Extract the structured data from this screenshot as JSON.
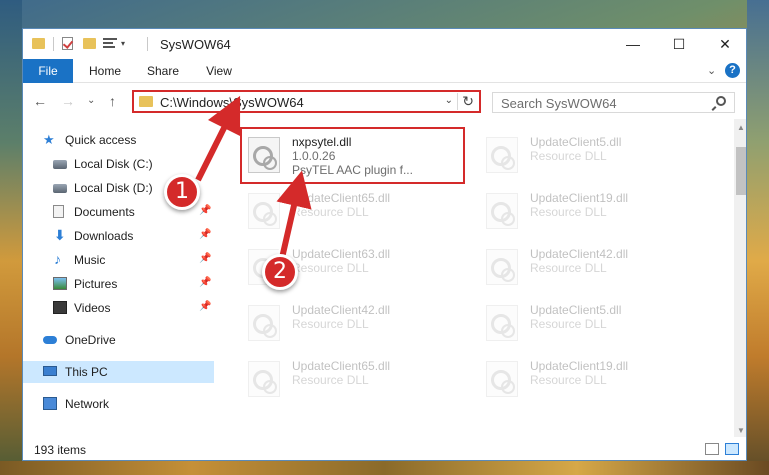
{
  "window": {
    "title": "SysWOW64",
    "minimize_glyph": "—",
    "maximize_glyph": "☐",
    "close_glyph": "✕"
  },
  "ribbon": {
    "tabs": [
      "File",
      "Home",
      "Share",
      "View"
    ],
    "expand_glyph": "⌄",
    "help_glyph": "?"
  },
  "nav": {
    "back_glyph": "←",
    "forward_glyph": "→",
    "recent_glyph": "⌄",
    "up_glyph": "↑",
    "address": "C:\\Windows\\SysWOW64",
    "address_dropdown_glyph": "⌄",
    "refresh_glyph": "↻",
    "search_placeholder": "Search SysWOW64"
  },
  "sidebar": {
    "items": [
      {
        "label": "Quick access",
        "icon": "star-icon"
      },
      {
        "label": "Local Disk (C:)",
        "icon": "disk-icon"
      },
      {
        "label": "Local Disk (D:)",
        "icon": "disk-icon"
      },
      {
        "label": "Documents",
        "icon": "documents-icon",
        "pinned": true
      },
      {
        "label": "Downloads",
        "icon": "download-icon",
        "pinned": true
      },
      {
        "label": "Music",
        "icon": "music-icon",
        "pinned": true
      },
      {
        "label": "Pictures",
        "icon": "pictures-icon",
        "pinned": true
      },
      {
        "label": "Videos",
        "icon": "videos-icon",
        "pinned": true
      },
      {
        "label": "OneDrive",
        "icon": "onedrive-icon"
      },
      {
        "label": "This PC",
        "icon": "this-pc-icon",
        "selected": true
      },
      {
        "label": "Network",
        "icon": "network-icon"
      }
    ],
    "pin_glyph": "📌"
  },
  "files": [
    {
      "name": "nxpsytel.dll",
      "line2": "1.0.0.26",
      "line3": "PsyTEL AAC plugin f..."
    },
    {
      "name": "UpdateClient5.dll",
      "line2": "Resource DLL"
    },
    {
      "name": "UpdateClient65.dll",
      "line2": "Resource DLL"
    },
    {
      "name": "UpdateClient19.dll",
      "line2": "Resource DLL"
    },
    {
      "name": "UpdateClient63.dll",
      "line2": "Resource DLL"
    },
    {
      "name": "UpdateClient42.dll",
      "line2": "Resource DLL"
    },
    {
      "name": "UpdateClient42.dll",
      "line2": "Resource DLL"
    },
    {
      "name": "UpdateClient5.dll",
      "line2": "Resource DLL"
    },
    {
      "name": "UpdateClient65.dll",
      "line2": "Resource DLL"
    },
    {
      "name": "UpdateClient19.dll",
      "line2": "Resource DLL"
    }
  ],
  "status": {
    "item_count": "193 items"
  },
  "annotations": {
    "badge1": "1",
    "badge2": "2",
    "color": "#d42a2a"
  }
}
